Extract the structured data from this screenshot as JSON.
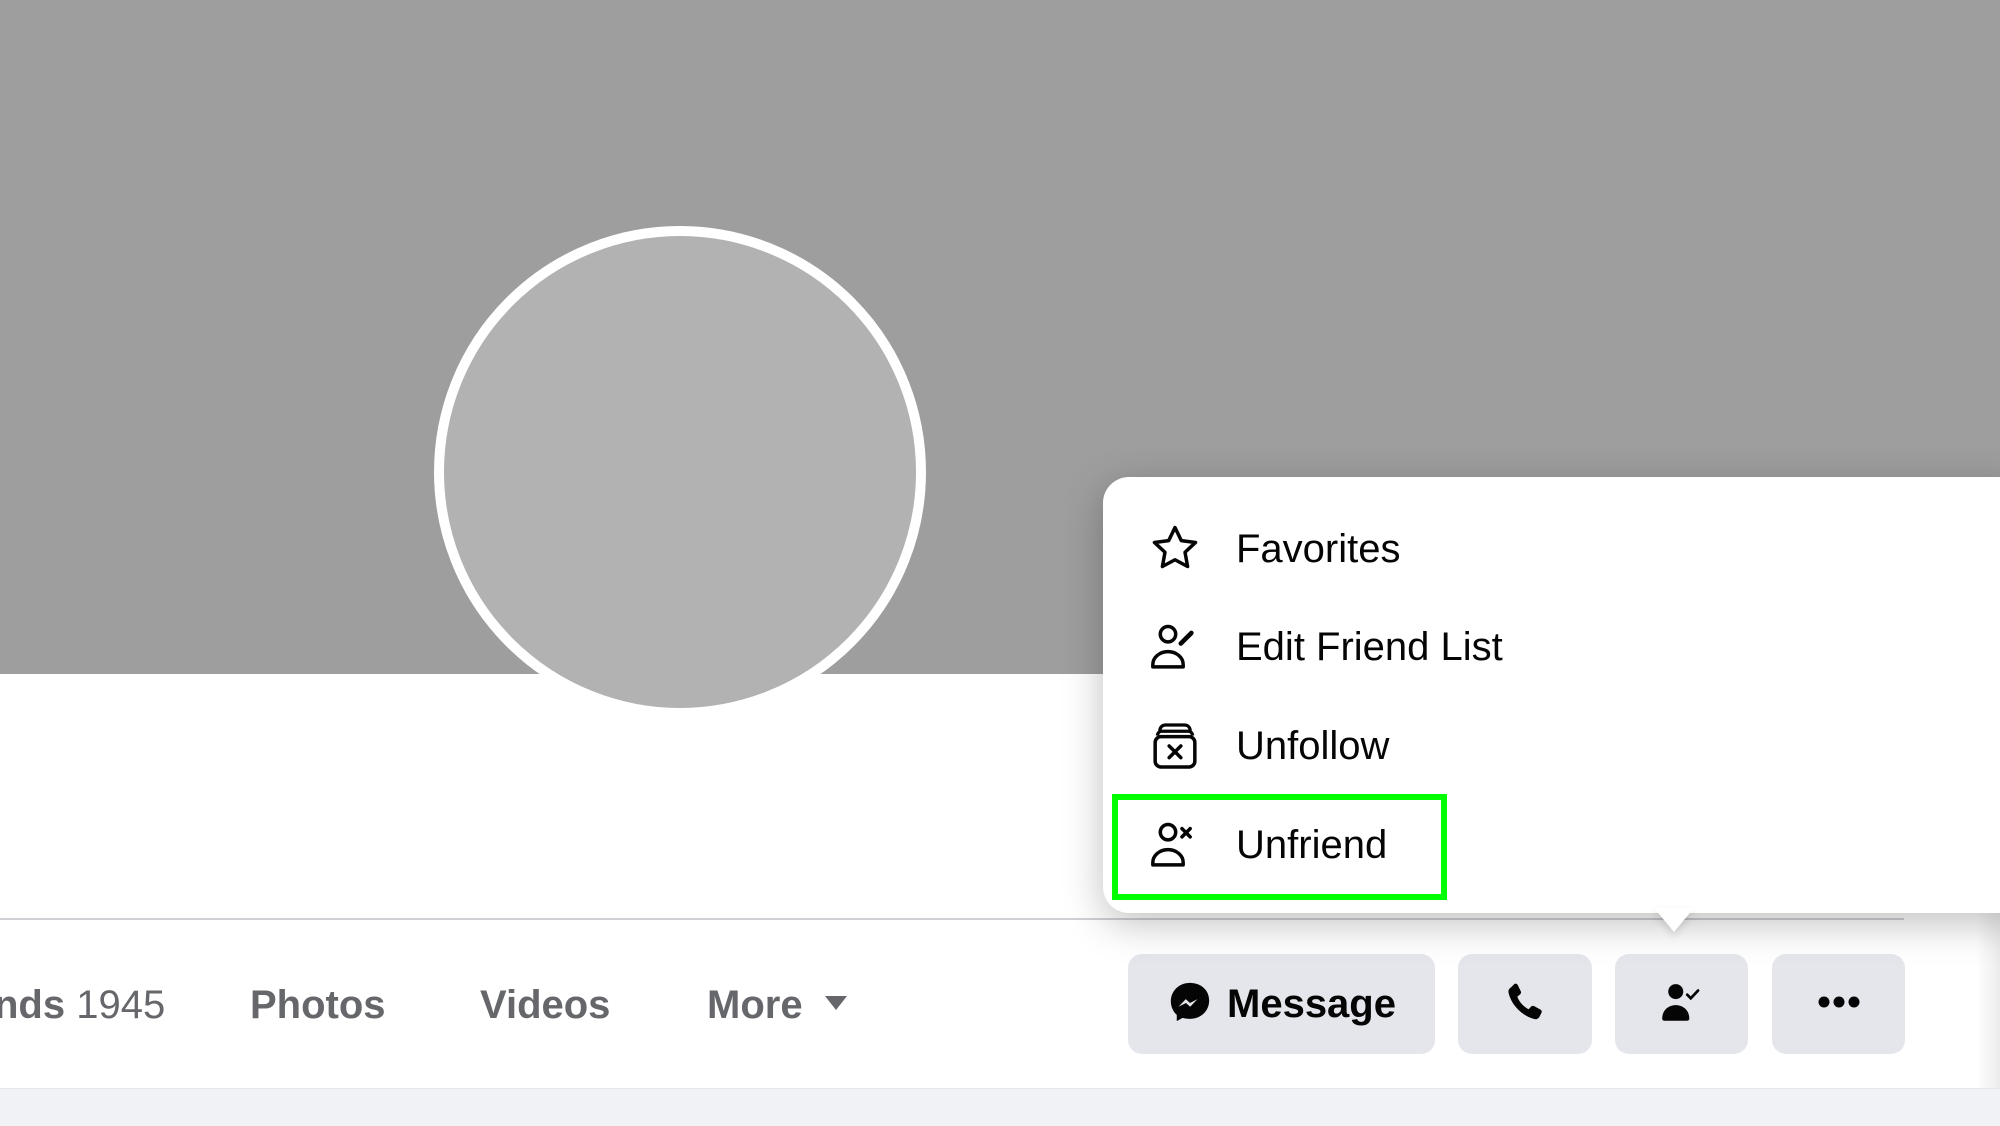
{
  "profile": {
    "cover_color": "#9e9e9e",
    "avatar_color": "#b2b2b2"
  },
  "tabs": [
    {
      "label": "nds",
      "count": "1945"
    },
    {
      "label": "Photos"
    },
    {
      "label": "Videos"
    },
    {
      "label": "More",
      "icon": "caret-down-icon"
    }
  ],
  "actions": {
    "message_label": "Message",
    "message_icon": "messenger-icon",
    "call_icon": "phone-icon",
    "friend_icon": "friend-check-icon",
    "more_icon": "ellipsis-icon",
    "button_bg": "#e4e6eb"
  },
  "friend_menu": {
    "items": [
      {
        "label": "Favorites",
        "icon": "star-icon"
      },
      {
        "label": "Edit Friend List",
        "icon": "edit-friend-icon"
      },
      {
        "label": "Unfollow",
        "icon": "unfollow-icon"
      },
      {
        "label": "Unfriend",
        "icon": "unfriend-icon",
        "highlighted": true
      }
    ],
    "highlight_color": "#00ff00"
  }
}
